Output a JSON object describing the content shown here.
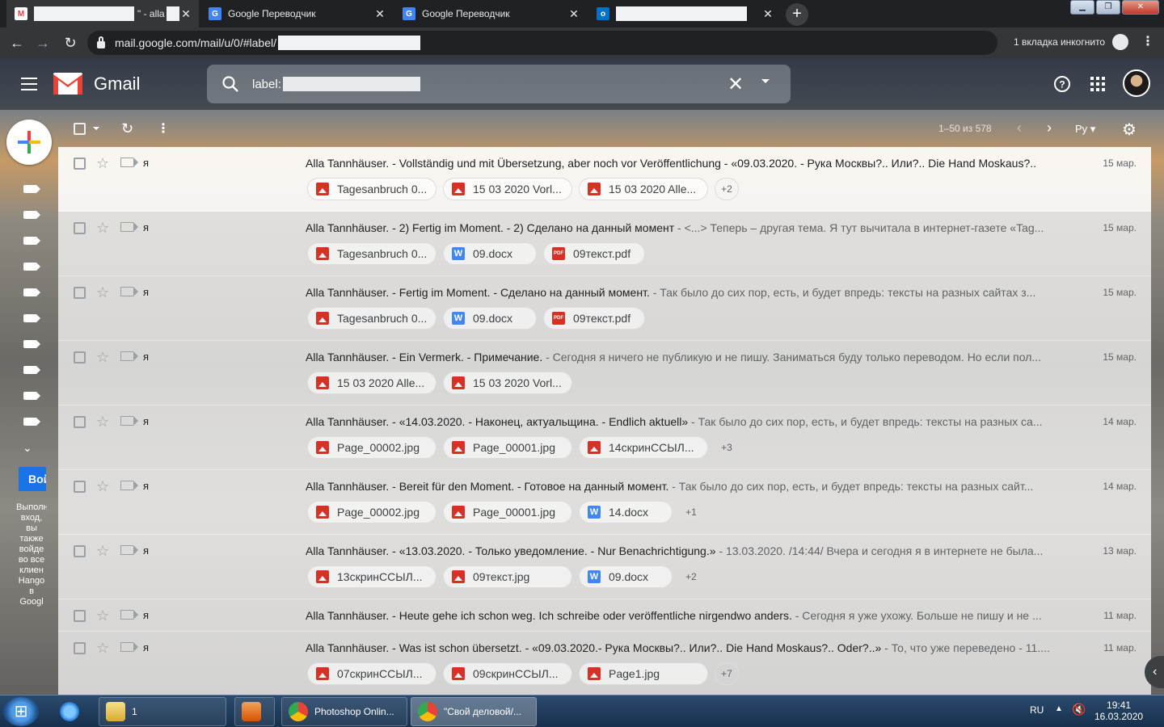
{
  "colors": {
    "gmail_red": "#EA4335",
    "chrome_dark": "#202124",
    "accent_blue": "#1A73E8"
  },
  "browser": {
    "tabs": [
      {
        "title": "\" - alla",
        "icon": "gmail-icon"
      },
      {
        "title": "Google Переводчик",
        "icon": "google-translate-icon"
      },
      {
        "title": "Google Переводчик",
        "icon": "google-translate-icon"
      },
      {
        "title": "",
        "icon": "outlook-icon"
      }
    ],
    "url": "mail.google.com/mail/u/0/#label/",
    "incognito_text": "1 вкладка инкогнито"
  },
  "gmail": {
    "app_name": "Gmail",
    "search_query": "label:",
    "pagination": "1–50 из 578",
    "input_lang": "Ру",
    "hangouts": {
      "button": "Вой",
      "text": "Выполн вход, вы также войде во все клиен Hango в Googl"
    }
  },
  "messages": [
    {
      "sender": "я",
      "subject": "Alla Tannhäuser. - Vollständig und mit Übersetzung, aber noch vor Veröffentlichung - «09.03.2020. - Рука Москвы?.. Или?.. Die Hand Moskaus?..",
      "snippet": "",
      "date": "15 мар.",
      "attachments": [
        {
          "name": "Tagesanbruch 0...",
          "type": "img"
        },
        {
          "name": "15 03 2020 Vorl...",
          "type": "img"
        },
        {
          "name": "15 03 2020 Alle...",
          "type": "img"
        }
      ],
      "more": "+2"
    },
    {
      "sender": "я",
      "subject": "Alla Tannhäuser. - 2) Fertig im Moment. - 2) Сделано на данный момент",
      "snippet": " - <...> Теперь – другая тема. Я тут вычитала в интернет-газете «Tag...",
      "date": "15 мар.",
      "attachments": [
        {
          "name": "Tagesanbruch 0...",
          "type": "img"
        },
        {
          "name": "09.docx",
          "type": "doc"
        },
        {
          "name": "09текст.pdf",
          "type": "pdf"
        }
      ],
      "more": ""
    },
    {
      "sender": "я",
      "subject": "Alla Tannhäuser. - Fertig im Moment. - Сделано на данный момент.",
      "snippet": " - Так было до сих пор, есть, и будет впредь: тексты на разных сайтах з...",
      "date": "15 мар.",
      "attachments": [
        {
          "name": "Tagesanbruch 0...",
          "type": "img"
        },
        {
          "name": "09.docx",
          "type": "doc"
        },
        {
          "name": "09текст.pdf",
          "type": "pdf"
        }
      ],
      "more": ""
    },
    {
      "sender": "я",
      "subject": "Alla Tannhäuser. - Ein Vermerk. - Примечание.",
      "snippet": " - Сегодня я ничего не публикую и не пишу. Заниматься буду только переводом. Но если пол...",
      "date": "15 мар.",
      "attachments": [
        {
          "name": "15 03 2020 Alle...",
          "type": "img"
        },
        {
          "name": "15 03 2020 Vorl...",
          "type": "img"
        }
      ],
      "more": ""
    },
    {
      "sender": "я",
      "subject": "Alla Tannhäuser. - «14.03.2020. - Наконец, актуальщина. - Endlich aktuell»",
      "snippet": " - Так было до сих пор, есть, и будет впредь: тексты на разных са...",
      "date": "14 мар.",
      "attachments": [
        {
          "name": "Page_00002.jpg",
          "type": "img"
        },
        {
          "name": "Page_00001.jpg",
          "type": "img"
        },
        {
          "name": "14скринССЫЛ...",
          "type": "img"
        }
      ],
      "more": "+3"
    },
    {
      "sender": "я",
      "subject": "Alla Tannhäuser. - Bereit für den Moment. - Готовое на данный момент.",
      "snippet": " - Так было до сих пор, есть, и будет впредь: тексты на разных сайт...",
      "date": "14 мар.",
      "attachments": [
        {
          "name": "Page_00002.jpg",
          "type": "img"
        },
        {
          "name": "Page_00001.jpg",
          "type": "img"
        },
        {
          "name": "14.docx",
          "type": "doc"
        }
      ],
      "more": "+1"
    },
    {
      "sender": "я",
      "subject": "Alla Tannhäuser. - «13.03.2020. - Только уведомление. - Nur Benachrichtigung.»",
      "snippet": " - 13.03.2020. /14:44/ Вчера и сегодня я в интернете не была...",
      "date": "13 мар.",
      "attachments": [
        {
          "name": "13скринССЫЛ...",
          "type": "img"
        },
        {
          "name": "09текст.jpg",
          "type": "img"
        },
        {
          "name": "09.docx",
          "type": "doc"
        }
      ],
      "more": "+2"
    },
    {
      "sender": "я",
      "subject": "Alla Tannhäuser. - Heute gehe ich schon weg. Ich schreibe oder veröffentliche nirgendwo anders.",
      "snippet": " - Сегодня я уже ухожу. Больше не пишу и не ...",
      "date": "11 мар.",
      "attachments": [],
      "more": ""
    },
    {
      "sender": "я",
      "subject": "Alla Tannhäuser. - Was ist schon übersetzt. - «09.03.2020.- Рука Москвы?.. Или?.. Die Hand Moskaus?.. Oder?..»",
      "snippet": " - То, что уже переведено - 11....",
      "date": "11 мар.",
      "attachments": [
        {
          "name": "07скринССЫЛ...",
          "type": "img"
        },
        {
          "name": "09скринССЫЛ...",
          "type": "img"
        },
        {
          "name": "Page1.jpg",
          "type": "img"
        }
      ],
      "more": "+7"
    }
  ],
  "taskbar": {
    "items": [
      {
        "label": "",
        "icon": "ie-icon"
      },
      {
        "label": "1",
        "icon": "folder-icon"
      },
      {
        "label": "",
        "icon": "media-player-icon"
      },
      {
        "label": "Photoshop Onlin...",
        "icon": "chrome-icon"
      },
      {
        "label": "\"Свой деловой/...",
        "icon": "chrome-icon"
      }
    ],
    "lang": "RU",
    "time": "19:41",
    "date": "16.03.2020"
  }
}
